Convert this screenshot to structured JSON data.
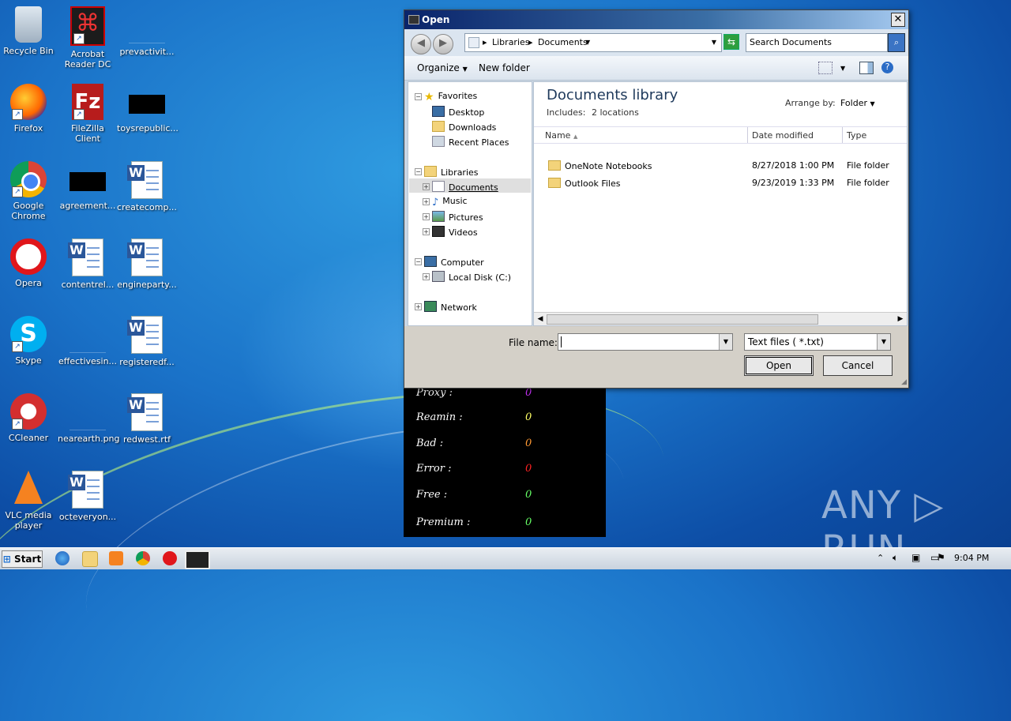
{
  "desktop": {
    "icons": [
      {
        "label": "Recycle Bin"
      },
      {
        "label": "Acrobat Reader DC"
      },
      {
        "label": "prevactivit..."
      },
      {
        "label": "Firefox"
      },
      {
        "label": "FileZilla Client"
      },
      {
        "label": "toysrepublic..."
      },
      {
        "label": "Google Chrome"
      },
      {
        "label": "agreement..."
      },
      {
        "label": "createcomp..."
      },
      {
        "label": "Opera"
      },
      {
        "label": "contentrel..."
      },
      {
        "label": "engineparty..."
      },
      {
        "label": "Skype"
      },
      {
        "label": "effectivesin..."
      },
      {
        "label": "registeredf..."
      },
      {
        "label": "CCleaner"
      },
      {
        "label": "nearearth.png"
      },
      {
        "label": "redwest.rtf"
      },
      {
        "label": "VLC media player"
      },
      {
        "label": "octeveryon..."
      }
    ]
  },
  "console": {
    "rows": [
      {
        "label": "Proxy :",
        "value": "0",
        "color": "#cc33ff"
      },
      {
        "label": "Reamin :",
        "value": "0",
        "color": "#ffff66"
      },
      {
        "label": "Bad :",
        "value": "0",
        "color": "#ff9933"
      },
      {
        "label": "Error :",
        "value": "0",
        "color": "#ff2222"
      },
      {
        "label": "Free :",
        "value": "0",
        "color": "#66ff66"
      },
      {
        "label": "Premium :",
        "value": "0",
        "color": "#66ff66"
      }
    ]
  },
  "dialog": {
    "title": "Open",
    "close_label": "✕",
    "address": {
      "crumb1": "Libraries",
      "crumb2": "Documents"
    },
    "search_placeholder": "Search Documents",
    "toolbar": {
      "organize": "Organize",
      "new_folder": "New folder"
    },
    "nav": {
      "favorites": "Favorites",
      "desktop": "Desktop",
      "downloads": "Downloads",
      "recent": "Recent Places",
      "libraries": "Libraries",
      "documents": "Documents",
      "music": "Music",
      "pictures": "Pictures",
      "videos": "Videos",
      "computer": "Computer",
      "local_disk": "Local Disk (C:)",
      "network": "Network"
    },
    "library": {
      "title": "Documents library",
      "includes": "Includes:",
      "locations": "2 locations",
      "arrange_label": "Arrange by:",
      "arrange_value": "Folder"
    },
    "columns": {
      "name": "Name",
      "date": "Date modified",
      "type": "Type"
    },
    "files": [
      {
        "name": "OneNote Notebooks",
        "date": "8/27/2018 1:00 PM",
        "type": "File folder"
      },
      {
        "name": "Outlook Files",
        "date": "9/23/2019 1:33 PM",
        "type": "File folder"
      }
    ],
    "filename_label": "File name:",
    "filename_value": "",
    "filetype_value": "Text files  ( *.txt)",
    "open_button": "Open",
    "cancel_button": "Cancel"
  },
  "taskbar": {
    "start": "Start",
    "clock": "9:04 PM"
  },
  "watermark": "ANY ▷ RUN"
}
